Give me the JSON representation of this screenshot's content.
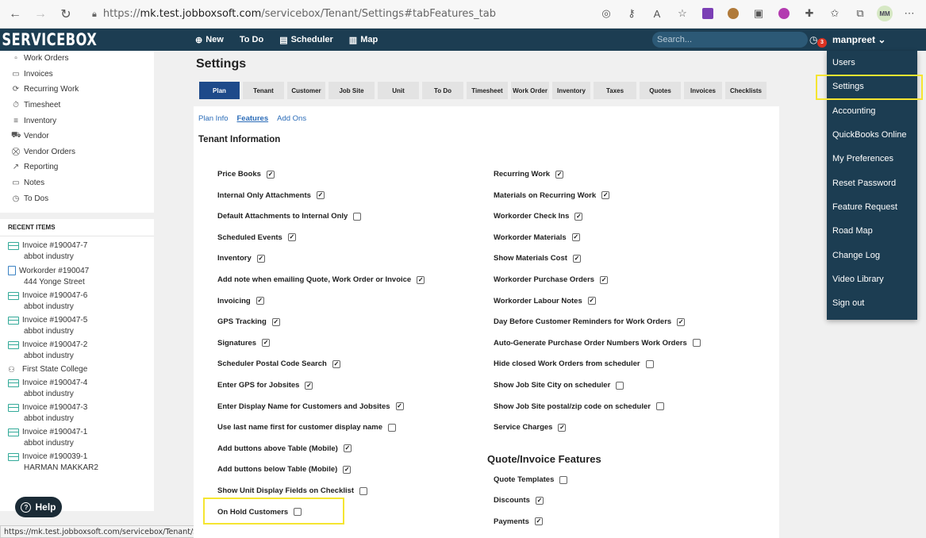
{
  "browser": {
    "url_prefix": "https://",
    "url_host": "mk.test.jobboxsoft.com",
    "url_path": "/servicebox/Tenant/Settings#tabFeatures_tab",
    "avatar": "MM"
  },
  "app": {
    "logo": "SERVICEBOX",
    "nav": [
      {
        "icon": "⊕",
        "label": "New"
      },
      {
        "icon": "",
        "label": "To Do"
      },
      {
        "icon": "▤",
        "label": "Scheduler"
      },
      {
        "icon": "▥",
        "label": "Map"
      }
    ],
    "search_placeholder": "Search...",
    "notification_count": "3",
    "user_name": "manpreet",
    "user_chevron": "⌄"
  },
  "sidebar": {
    "items": [
      {
        "icon": "▫",
        "label": "Work Orders"
      },
      {
        "icon": "▭",
        "label": "Invoices"
      },
      {
        "icon": "⟳",
        "label": "Recurring Work"
      },
      {
        "icon": "⏱",
        "label": "Timesheet"
      },
      {
        "icon": "≡",
        "label": "Inventory"
      },
      {
        "icon": "⛟",
        "label": "Vendor"
      },
      {
        "icon": "⛒",
        "label": "Vendor Orders"
      },
      {
        "icon": "↗",
        "label": "Reporting"
      },
      {
        "icon": "▭",
        "label": "Notes"
      },
      {
        "icon": "◷",
        "label": "To Dos"
      }
    ]
  },
  "recent": {
    "title": "RECENT ITEMS",
    "items": [
      {
        "type": "invoice",
        "title": "Invoice #190047-7",
        "sub": "abbot industry"
      },
      {
        "type": "workorder",
        "title": "Workorder #190047",
        "sub": "444 Yonge Street"
      },
      {
        "type": "invoice",
        "title": "Invoice #190047-6",
        "sub": "abbot industry"
      },
      {
        "type": "invoice",
        "title": "Invoice #190047-5",
        "sub": "abbot industry"
      },
      {
        "type": "invoice",
        "title": "Invoice #190047-2",
        "sub": "abbot industry"
      },
      {
        "type": "customer",
        "title": "First State College",
        "sub": ""
      },
      {
        "type": "invoice",
        "title": "Invoice #190047-4",
        "sub": "abbot industry"
      },
      {
        "type": "invoice",
        "title": "Invoice #190047-3",
        "sub": "abbot industry"
      },
      {
        "type": "invoice",
        "title": "Invoice #190047-1",
        "sub": "abbot industry"
      },
      {
        "type": "invoice",
        "title": "Invoice #190039-1",
        "sub": "HARMAN MAKKAR2"
      }
    ],
    "help_label": "Help"
  },
  "status_url": "https://mk.test.jobboxsoft.com/servicebox/Tenant/Settings",
  "main": {
    "title": "Settings",
    "tabs": [
      "Plan",
      "Tenant",
      "Customer",
      "Job Site",
      "Unit",
      "To Do",
      "Timesheet",
      "Work Order",
      "Inventory",
      "Taxes",
      "Quotes",
      "Invoices",
      "Checklists"
    ],
    "active_tab": "Plan",
    "subnav": [
      "Plan Info",
      "Features",
      "Add Ons"
    ],
    "section_title": "Tenant Information",
    "left_features": [
      {
        "label": "Price Books",
        "checked": true
      },
      {
        "label": "Internal Only Attachments",
        "checked": true
      },
      {
        "label": "Default Attachments to Internal Only",
        "checked": false
      },
      {
        "label": "Scheduled Events",
        "checked": true
      },
      {
        "label": "Inventory",
        "checked": true
      },
      {
        "label": "Add note when emailing Quote, Work Order or Invoice",
        "checked": true
      },
      {
        "label": "Invoicing",
        "checked": true
      },
      {
        "label": "GPS Tracking",
        "checked": true
      },
      {
        "label": "Signatures",
        "checked": true
      },
      {
        "label": "Scheduler Postal Code Search",
        "checked": true
      },
      {
        "label": "Enter GPS for Jobsites",
        "checked": true
      },
      {
        "label": "Enter Display Name for Customers and Jobsites",
        "checked": true
      },
      {
        "label": "Use last name first for customer display name",
        "checked": false
      },
      {
        "label": "Add buttons above Table (Mobile)",
        "checked": true
      },
      {
        "label": "Add buttons below Table (Mobile)",
        "checked": true
      },
      {
        "label": "Show Unit Display Fields on Checklist",
        "checked": false
      },
      {
        "label": "On Hold Customers",
        "checked": false
      }
    ],
    "right_features": [
      {
        "label": "Recurring Work",
        "checked": true
      },
      {
        "label": "Materials on Recurring Work",
        "checked": true
      },
      {
        "label": "Workorder Check Ins",
        "checked": true
      },
      {
        "label": "Workorder Materials",
        "checked": true
      },
      {
        "label": "Show Materials Cost",
        "checked": true
      },
      {
        "label": "Workorder Purchase Orders",
        "checked": true
      },
      {
        "label": "Workorder Labour Notes",
        "checked": true
      },
      {
        "label": "Day Before Customer Reminders for Work Orders",
        "checked": true
      },
      {
        "label": "Auto-Generate Purchase Order Numbers Work Orders",
        "checked": false
      },
      {
        "label": "Hide closed Work Orders from scheduler",
        "checked": false
      },
      {
        "label": "Show Job Site City on scheduler",
        "checked": false
      },
      {
        "label": "Show Job Site postal/zip code on scheduler",
        "checked": false
      },
      {
        "label": "Service Charges",
        "checked": true
      }
    ],
    "quote_section_title": "Quote/Invoice Features",
    "quote_features": [
      {
        "label": "Quote Templates",
        "checked": false
      },
      {
        "label": "Discounts",
        "checked": true
      },
      {
        "label": "Payments",
        "checked": true
      }
    ]
  },
  "dropdown": {
    "items": [
      "Users",
      "Settings",
      "Accounting",
      "QuickBooks Online",
      "My Preferences",
      "Reset Password",
      "Feature Request",
      "Road Map",
      "Change Log",
      "Video Library",
      "Sign out"
    ],
    "highlighted": "Settings"
  },
  "colors": {
    "header": "#1c3d52",
    "active_tab": "#1e4a8a",
    "link": "#2b6cb8",
    "highlight": "#f5e531"
  }
}
